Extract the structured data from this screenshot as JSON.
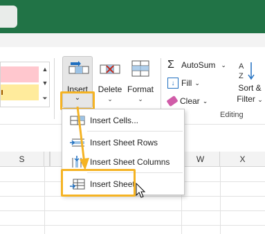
{
  "ribbon": {
    "cells": {
      "insert_label": "Insert",
      "delete_label": "Delete",
      "format_label": "Format"
    },
    "editing": {
      "autosum_label": "AutoSum",
      "fill_label": "Fill",
      "clear_label": "Clear",
      "sort_label": "Sort &",
      "filter_label": "Filter",
      "group_label": "Editing"
    }
  },
  "menu": {
    "items": [
      {
        "label": "Insert Cells...",
        "icon": "insert-cells-icon"
      },
      {
        "label": "Insert Sheet Rows",
        "icon": "insert-rows-icon"
      },
      {
        "label": "Insert Sheet Columns",
        "icon": "insert-columns-icon"
      },
      {
        "label": "Insert Sheet",
        "icon": "insert-sheet-icon"
      }
    ]
  },
  "grid": {
    "columns": [
      "S",
      "W",
      "X"
    ]
  },
  "colors": {
    "accent": "#217346",
    "highlight": "#f5b323",
    "bad_style": "#ffc7ce",
    "neutral_style": "#ffeb9c"
  }
}
